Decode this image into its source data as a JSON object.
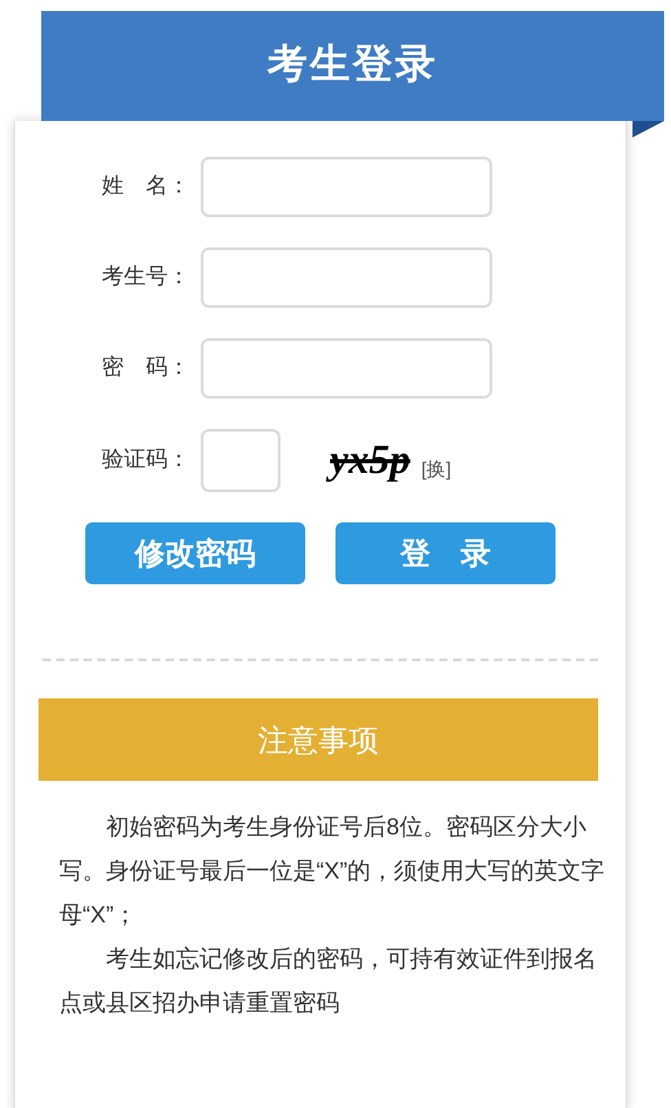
{
  "header": {
    "title": "考生登录"
  },
  "fields": [
    {
      "label": "姓　名："
    },
    {
      "label": "考生号："
    },
    {
      "label": "密　码："
    }
  ],
  "captcha": {
    "label": "验证码：",
    "code": "yx5p",
    "refresh": "[换]"
  },
  "buttons": [
    "修改密码",
    "登　录"
  ],
  "notice": {
    "title": "注意事项",
    "paragraphs": [
      "初始密码为考生身份证号后8位。密码区分大小写。身份证号最后一位是“X”的，须使用大写的英文字母“X”；",
      "考生如忘记修改后的密码，可持有效证件到报名点或县区招办申请重置密码"
    ]
  }
}
